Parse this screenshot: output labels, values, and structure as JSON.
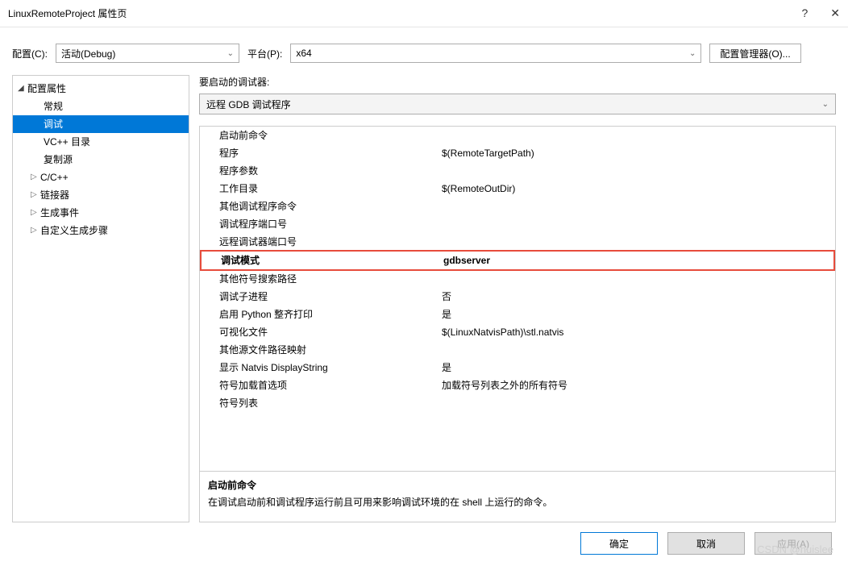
{
  "window": {
    "title": "LinuxRemoteProject 属性页",
    "help": "?",
    "close": "✕"
  },
  "configRow": {
    "configLabel": "配置(C):",
    "configValue": "活动(Debug)",
    "platformLabel": "平台(P):",
    "platformValue": "x64",
    "configMgrButton": "配置管理器(O)..."
  },
  "tree": {
    "root": "配置属性",
    "items": [
      "常规",
      "调试",
      "VC++ 目录",
      "复制源"
    ],
    "expandable": [
      "C/C++",
      "链接器",
      "生成事件",
      "自定义生成步骤"
    ],
    "selected": "调试"
  },
  "debugger": {
    "label": "要启动的调试器:",
    "value": "远程 GDB 调试程序"
  },
  "properties": [
    {
      "label": "启动前命令",
      "value": ""
    },
    {
      "label": "程序",
      "value": "$(RemoteTargetPath)"
    },
    {
      "label": "程序参数",
      "value": ""
    },
    {
      "label": "工作目录",
      "value": "$(RemoteOutDir)"
    },
    {
      "label": "其他调试程序命令",
      "value": ""
    },
    {
      "label": "调试程序端口号",
      "value": ""
    },
    {
      "label": "远程调试器端口号",
      "value": ""
    },
    {
      "label": "调试模式",
      "value": "gdbserver",
      "highlight": true
    },
    {
      "label": "其他符号搜索路径",
      "value": ""
    },
    {
      "label": "调试子进程",
      "value": "否"
    },
    {
      "label": "启用 Python 整齐打印",
      "value": "是"
    },
    {
      "label": "可视化文件",
      "value": "$(LinuxNatvisPath)\\stl.natvis"
    },
    {
      "label": "其他源文件路径映射",
      "value": ""
    },
    {
      "label": "显示 Natvis DisplayString",
      "value": "是"
    },
    {
      "label": "符号加载首选项",
      "value": "加载符号列表之外的所有符号"
    },
    {
      "label": "符号列表",
      "value": ""
    }
  ],
  "description": {
    "title": "启动前命令",
    "text": "在调试启动前和调试程序运行前且可用来影响调试环境的在 shell 上运行的命令。"
  },
  "buttons": {
    "ok": "确定",
    "cancel": "取消",
    "apply": "应用(A)"
  },
  "watermark": "CSDN @huislee"
}
